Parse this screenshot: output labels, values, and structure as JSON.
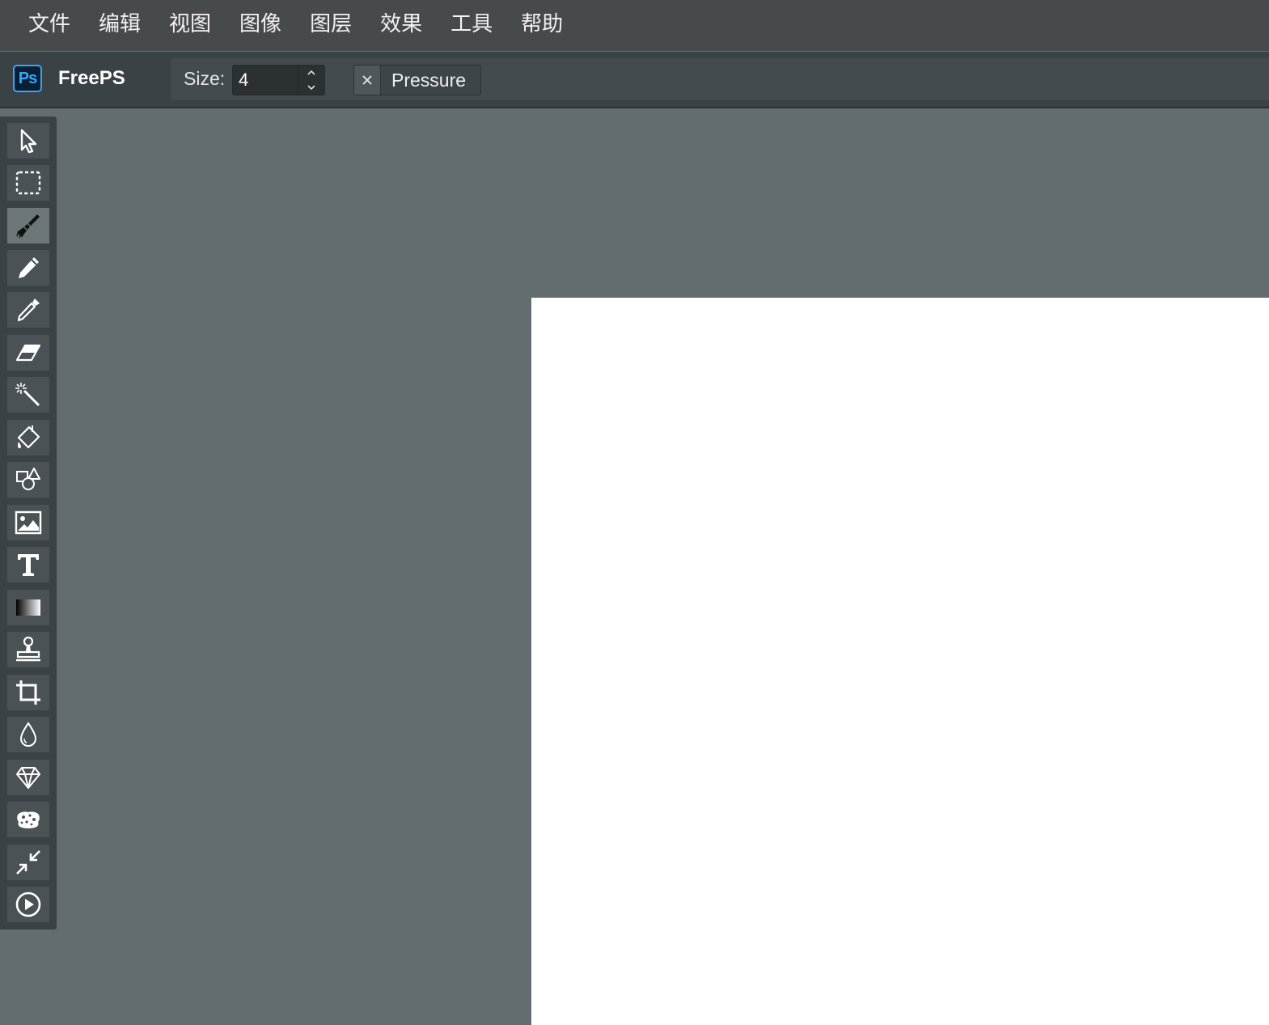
{
  "menu": [
    "文件",
    "编辑",
    "视图",
    "图像",
    "图层",
    "效果",
    "工具",
    "帮助"
  ],
  "brand": {
    "logo_text": "Ps",
    "name": "FreePS"
  },
  "attributes": {
    "size_label": "Size:",
    "size_value": "4",
    "pressure_label": "Pressure",
    "pressure_enabled": false
  },
  "tools": [
    {
      "name": "select-icon",
      "active": false
    },
    {
      "name": "marquee-select-icon",
      "active": false
    },
    {
      "name": "brush-icon",
      "active": true
    },
    {
      "name": "pencil-icon",
      "active": false
    },
    {
      "name": "eyedropper-icon",
      "active": false
    },
    {
      "name": "eraser-icon",
      "active": false
    },
    {
      "name": "magic-wand-icon",
      "active": false
    },
    {
      "name": "fill-bucket-icon",
      "active": false
    },
    {
      "name": "shapes-icon",
      "active": false
    },
    {
      "name": "image-icon",
      "active": false
    },
    {
      "name": "text-icon",
      "active": false
    },
    {
      "name": "gradient-icon",
      "active": false
    },
    {
      "name": "clone-stamp-icon",
      "active": false
    },
    {
      "name": "crop-icon",
      "active": false
    },
    {
      "name": "blur-drop-icon",
      "active": false
    },
    {
      "name": "sharpen-diamond-icon",
      "active": false
    },
    {
      "name": "sponge-icon",
      "active": false
    },
    {
      "name": "resize-arrows-icon",
      "active": false
    },
    {
      "name": "play-animation-icon",
      "active": false
    }
  ],
  "colors": {
    "accent": "#31a8ff",
    "workspace": "#636c6e",
    "canvas": "#ffffff"
  }
}
